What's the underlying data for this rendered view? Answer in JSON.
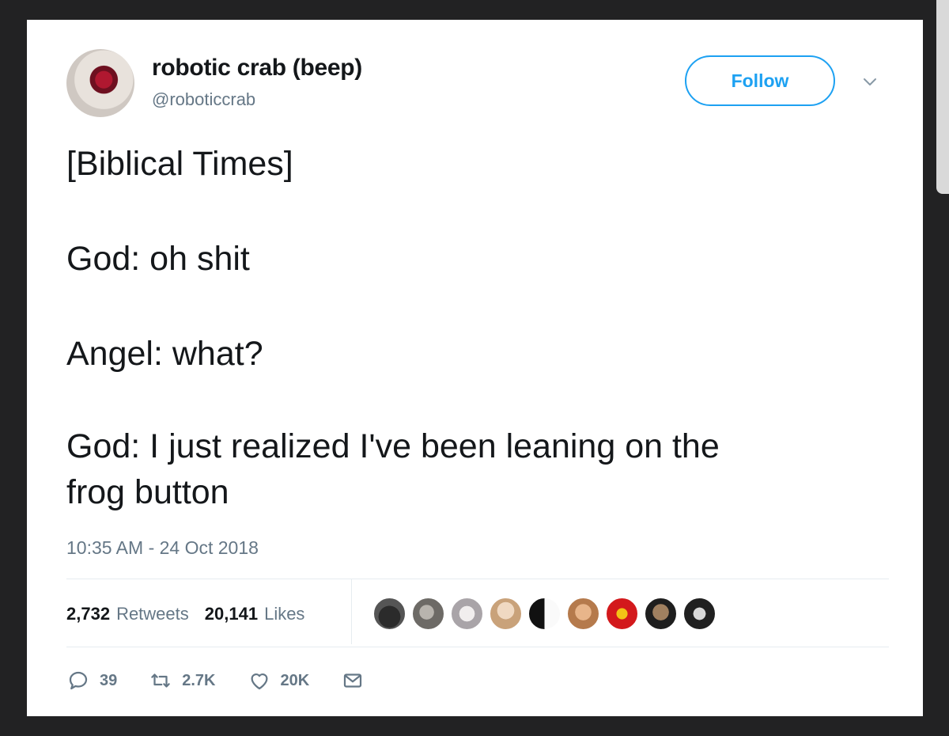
{
  "author": {
    "display_name": "robotic crab (beep)",
    "handle": "@roboticcrab"
  },
  "follow_label": "Follow",
  "tweet_lines": [
    "[Biblical Times]",
    "God: oh shit",
    "Angel: what?",
    "God: I just realized I've been leaning on the",
    "frog button"
  ],
  "timestamp": "10:35 AM - 24 Oct 2018",
  "stats": {
    "retweets_count": "2,732",
    "retweets_label": "Retweets",
    "likes_count": "20,141",
    "likes_label": "Likes"
  },
  "actions": {
    "reply_count": "39",
    "retweet_count": "2.7K",
    "like_count": "20K"
  },
  "colors": {
    "accent": "#1da1f2",
    "text_primary": "#14171a",
    "text_secondary": "#657786"
  },
  "icons": [
    "chevron-down-icon",
    "reply-icon",
    "retweet-icon",
    "heart-icon",
    "direct-message-icon"
  ]
}
